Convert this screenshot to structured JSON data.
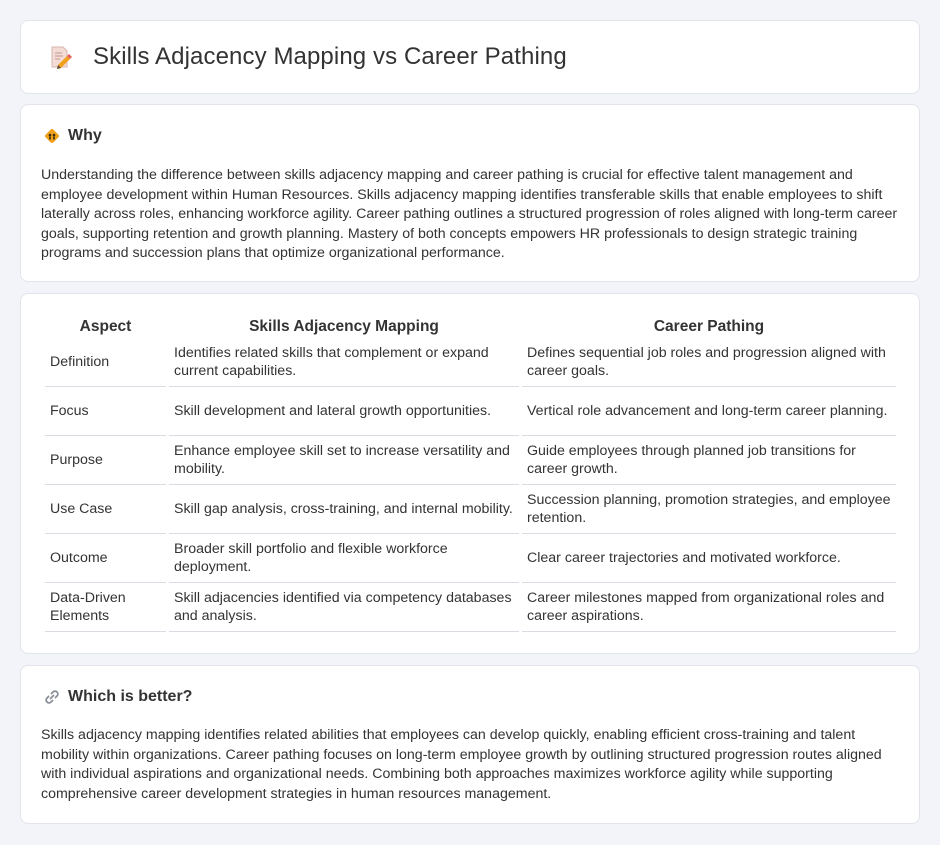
{
  "header": {
    "title": "Skills Adjacency Mapping vs Career Pathing",
    "icon": "document-pencil-icon"
  },
  "why": {
    "icon": "diamond-sign-icon",
    "title": "Why",
    "body": "Understanding the difference between skills adjacency mapping and career pathing is crucial for effective talent management and employee development within Human Resources. Skills adjacency mapping identifies transferable skills that enable employees to shift laterally across roles, enhancing workforce agility. Career pathing outlines a structured progression of roles aligned with long-term career goals, supporting retention and growth planning. Mastery of both concepts empowers HR professionals to design strategic training programs and succession plans that optimize organizational performance."
  },
  "comparison": {
    "headers": [
      "Aspect",
      "Skills Adjacency Mapping",
      "Career Pathing"
    ],
    "rows": [
      [
        "Definition",
        "Identifies related skills that complement or expand current capabilities.",
        "Defines sequential job roles and progression aligned with career goals."
      ],
      [
        "Focus",
        "Skill development and lateral growth opportunities.",
        "Vertical role advancement and long-term career planning."
      ],
      [
        "Purpose",
        "Enhance employee skill set to increase versatility and mobility.",
        "Guide employees through planned job transitions for career growth."
      ],
      [
        "Use Case",
        "Skill gap analysis, cross-training, and internal mobility.",
        "Succession planning, promotion strategies, and employee retention."
      ],
      [
        "Outcome",
        "Broader skill portfolio and flexible workforce deployment.",
        "Clear career trajectories and motivated workforce."
      ],
      [
        "Data-Driven Elements",
        "Skill adjacencies identified via competency databases and analysis.",
        "Career milestones mapped from organizational roles and career aspirations."
      ]
    ]
  },
  "better": {
    "icon": "link-icon",
    "title": "Which is better?",
    "body": "Skills adjacency mapping identifies related abilities that employees can develop quickly, enabling efficient cross-training and talent mobility within organizations. Career pathing focuses on long-term employee growth by outlining structured progression routes aligned with individual aspirations and organizational needs. Combining both approaches maximizes workforce agility while supporting comprehensive career development strategies in human resources management."
  },
  "colors": {
    "background": "#f2f4f9",
    "card": "#ffffff",
    "text": "#333333",
    "accent_orange": "#f0a11e"
  }
}
